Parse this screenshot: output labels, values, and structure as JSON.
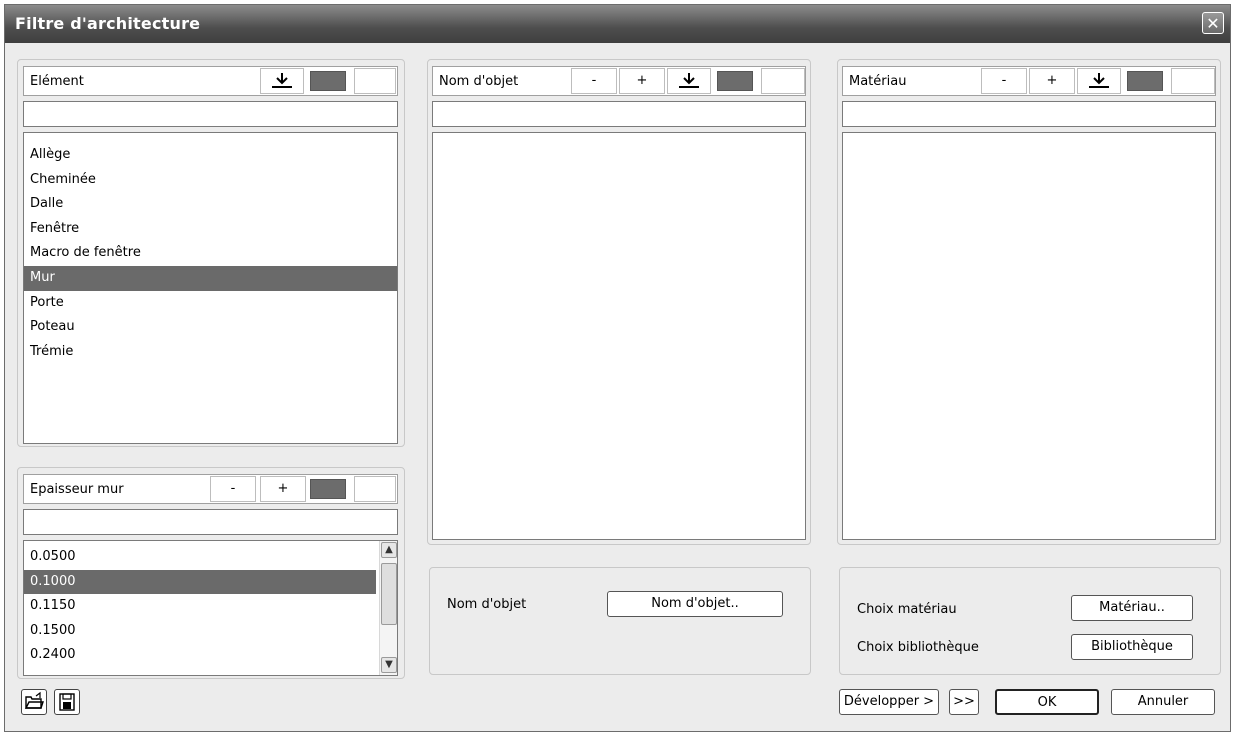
{
  "window": {
    "title": "Filtre d'architecture",
    "close_glyph": "✕"
  },
  "element_panel": {
    "header_label": "Elément",
    "filter_value": "",
    "items": [
      "Allège",
      "Cheminée",
      "Dalle",
      "Fenêtre",
      "Macro de fenêtre",
      "Mur",
      "Porte",
      "Poteau",
      "Trémie"
    ],
    "selected_item": "Mur"
  },
  "thickness_panel": {
    "header_label": "Epaisseur mur",
    "minus_label": "-",
    "plus_label": "+",
    "filter_value": "",
    "items": [
      "0.0500",
      "0.1000",
      "0.1150",
      "0.1500",
      "0.2400"
    ],
    "selected_item": "0.1000"
  },
  "object_panel": {
    "header_label": "Nom d'objet",
    "minus_label": "-",
    "plus_label": "+",
    "filter_value": "",
    "items": [],
    "group_label": "Nom d'objet",
    "group_button": "Nom d'objet.."
  },
  "material_panel": {
    "header_label": "Matériau",
    "minus_label": "-",
    "plus_label": "+",
    "filter_value": "",
    "items": [],
    "choose_material_label": "Choix matériau",
    "choose_material_button": "Matériau..",
    "choose_library_label": "Choix bibliothèque",
    "choose_library_button": "Bibliothèque"
  },
  "footer": {
    "develop_button": "Développer >",
    "expand_button": ">>",
    "ok_button": "OK",
    "cancel_button": "Annuler"
  },
  "colors": {
    "selection": "#6a6a6a",
    "swatch": "#6c6c6c",
    "titlebar": "#4e4e4e"
  }
}
